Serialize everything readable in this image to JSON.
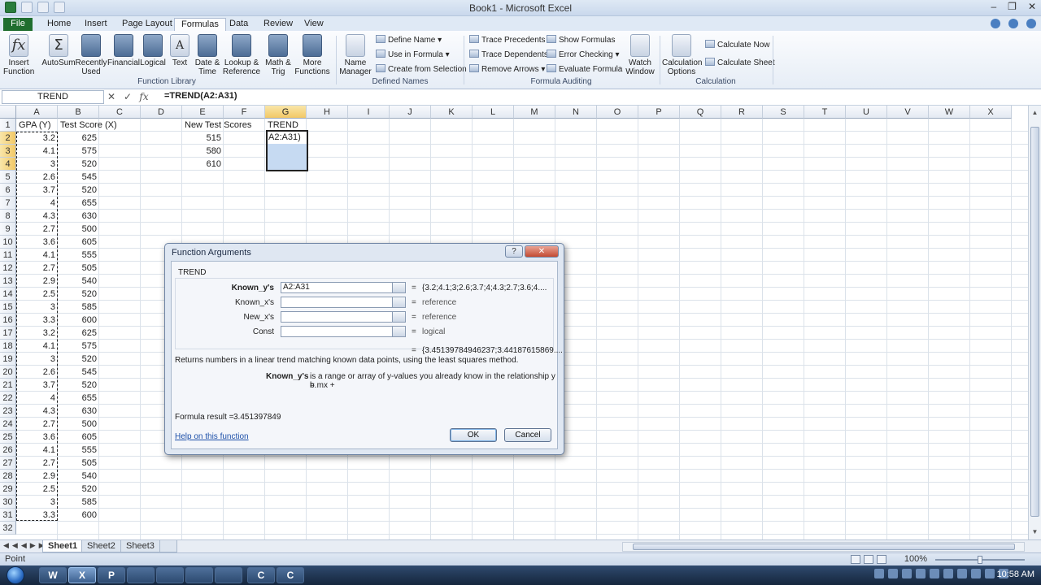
{
  "window": {
    "title": "Book1 - Microsoft Excel"
  },
  "tabs": [
    {
      "label": "File"
    },
    {
      "label": "Home"
    },
    {
      "label": "Insert"
    },
    {
      "label": "Page Layout"
    },
    {
      "label": "Formulas"
    },
    {
      "label": "Data"
    },
    {
      "label": "Review"
    },
    {
      "label": "View"
    }
  ],
  "ribbon": {
    "function_library": {
      "label": "Function Library",
      "insert_function": "Insert Function",
      "autosum": "AutoSum",
      "recently_used": "Recently Used",
      "financial": "Financial",
      "logical": "Logical",
      "text": "Text",
      "date_time": "Date & Time",
      "lookup_reference": "Lookup & Reference",
      "math_trig": "Math & Trig",
      "more_functions": "More Functions"
    },
    "defined_names": {
      "label": "Defined Names",
      "name_manager": "Name Manager",
      "define_name": "Define Name",
      "use_in_formula": "Use in Formula",
      "create_from_selection": "Create from Selection"
    },
    "formula_auditing": {
      "label": "Formula Auditing",
      "trace_precedents": "Trace Precedents",
      "trace_dependents": "Trace Dependents",
      "remove_arrows": "Remove Arrows",
      "show_formulas": "Show Formulas",
      "error_checking": "Error Checking",
      "evaluate_formula": "Evaluate Formula",
      "watch_window": "Watch Window"
    },
    "calculation": {
      "label": "Calculation",
      "calculation_options": "Calculation Options",
      "calculate_now": "Calculate Now",
      "calculate_sheet": "Calculate Sheet"
    }
  },
  "formula_bar": {
    "name_box": "TREND",
    "formula": "=TREND(A2:A31)"
  },
  "columns": [
    "A",
    "B",
    "C",
    "D",
    "E",
    "F",
    "G",
    "H",
    "I",
    "J",
    "K",
    "L",
    "M",
    "N",
    "O",
    "P",
    "Q",
    "R",
    "S",
    "T",
    "U",
    "V",
    "W",
    "X"
  ],
  "rows": [
    "1",
    "2",
    "3",
    "4",
    "5",
    "6",
    "7",
    "8",
    "9",
    "10",
    "11",
    "12",
    "13",
    "14",
    "15",
    "16",
    "17",
    "18",
    "19",
    "20",
    "21",
    "22",
    "23",
    "24",
    "25",
    "26",
    "27",
    "28",
    "29",
    "30",
    "31",
    "32"
  ],
  "sheet": {
    "headers": {
      "A1": "GPA (Y)",
      "B1": "Test Score (X)",
      "E1": "New Test Scores",
      "G1": "TREND"
    },
    "gpa": [
      "3.2",
      "4.1",
      "3",
      "2.6",
      "3.7",
      "4",
      "4.3",
      "2.7",
      "3.6",
      "4.1",
      "2.7",
      "2.9",
      "2.5",
      "3",
      "3.3",
      "3.2",
      "4.1",
      "3",
      "2.6",
      "3.7",
      "4",
      "4.3",
      "2.7",
      "3.6",
      "4.1",
      "2.7",
      "2.9",
      "2.5",
      "3",
      "3.3"
    ],
    "score": [
      "625",
      "575",
      "520",
      "545",
      "520",
      "655",
      "630",
      "500",
      "605",
      "555",
      "505",
      "540",
      "520",
      "585",
      "600",
      "625",
      "575",
      "520",
      "545",
      "520",
      "655",
      "630",
      "500",
      "605",
      "555",
      "505",
      "540",
      "520",
      "585",
      "600"
    ],
    "new_scores": [
      "515",
      "580",
      "610"
    ],
    "g2_edit": "A2:A31)"
  },
  "sheet_tabs": [
    "Sheet1",
    "Sheet2",
    "Sheet3"
  ],
  "status": {
    "mode": "Point",
    "zoom": "100%"
  },
  "taskbar": {
    "time": "10:58 AM",
    "apps": [
      "W",
      "X",
      "P",
      "",
      "",
      "",
      "C",
      "C"
    ]
  },
  "dialog": {
    "title": "Function Arguments",
    "function_name": "TREND",
    "args": [
      {
        "label": "Known_y's",
        "value": "A2:A31",
        "result": "{3.2;4.1;3;2.6;3.7;4;4.3;2.7;3.6;4...."
      },
      {
        "label": "Known_x's",
        "value": "",
        "result": "reference"
      },
      {
        "label": "New_x's",
        "value": "",
        "result": "reference"
      },
      {
        "label": "Const",
        "value": "",
        "result": "logical"
      }
    ],
    "eq": "=",
    "overall_result": "{3.45139784946237;3.44187615869....",
    "description": "Returns numbers in a linear trend matching known data points, using the least squares method.",
    "arg_help_label": "Known_y's",
    "arg_help_text_1": "is a range or array of y-values you already know in the relationship y = mx +",
    "arg_help_text_2": "b.",
    "formula_result_label": "Formula result =",
    "formula_result_value": "3.451397849",
    "help_link": "Help on this function",
    "ok": "OK",
    "cancel": "Cancel"
  }
}
